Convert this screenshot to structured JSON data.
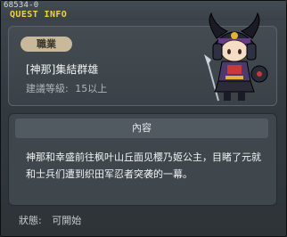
{
  "header": {
    "quest_id": "68534-0",
    "title": "QUEST INFO"
  },
  "job": {
    "badge_label": "職業",
    "name": "[神那]集結群雄",
    "level_label": "建議等級:",
    "level_value": "15以上"
  },
  "content": {
    "header": "內容",
    "text": "神那和幸盛前往枫叶山丘面见樱乃姬公主，目睹了元就和士兵们遭到织田军忍者突袭的一幕。"
  },
  "status": {
    "label": "狀態:",
    "value": "可開始"
  },
  "colors": {
    "title": "#f2d23a",
    "badge": "#c7b99a",
    "panel": "#3f474c"
  }
}
